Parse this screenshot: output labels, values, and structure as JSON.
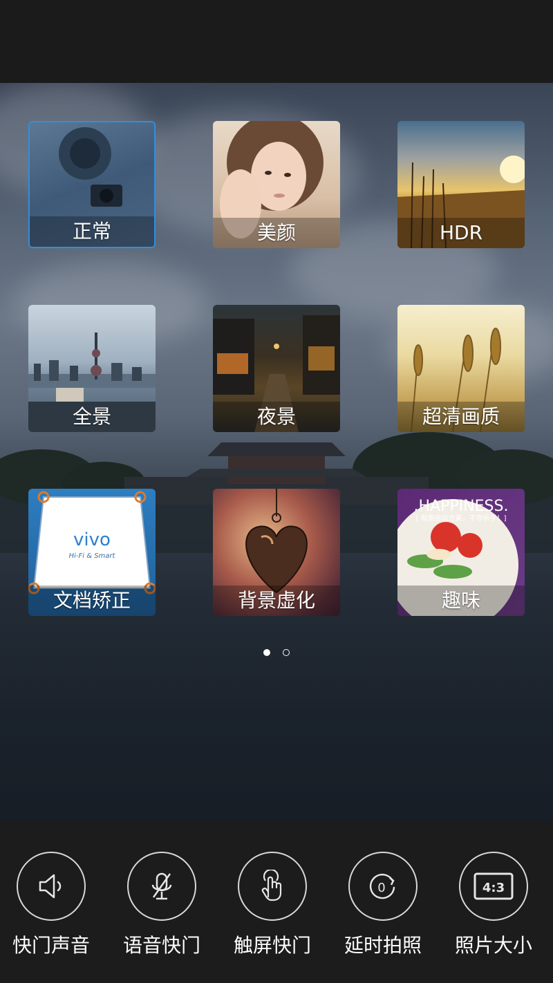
{
  "modes": [
    {
      "label": "正常",
      "selected": true
    },
    {
      "label": "美颜",
      "selected": false
    },
    {
      "label": "HDR",
      "selected": false
    },
    {
      "label": "全景",
      "selected": false
    },
    {
      "label": "夜景",
      "selected": false
    },
    {
      "label": "超清画质",
      "selected": false
    },
    {
      "label": "文档矫正",
      "selected": false,
      "logo_text": "vivo",
      "logo_subtext": "Hi-Fi & Smart"
    },
    {
      "label": "背景虚化",
      "selected": false
    },
    {
      "label": "趣味",
      "selected": false,
      "overlay_text": ".HAPPINESS.",
      "overlay_subtext": "[ 有朋自远方来，不亦乐乎！]"
    }
  ],
  "pager": {
    "pages": 2,
    "current": 1
  },
  "settings": [
    {
      "label": "快门声音",
      "icon": "speaker-icon"
    },
    {
      "label": "语音快门",
      "icon": "microphone-muted-icon"
    },
    {
      "label": "触屏快门",
      "icon": "touch-hand-icon"
    },
    {
      "label": "延时拍照",
      "icon": "timer-icon"
    },
    {
      "label": "照片大小",
      "icon": "aspect-ratio-icon",
      "icon_text": "4:3"
    }
  ],
  "colors": {
    "selected_border": "#2f8fe0",
    "bar_bg": "#1c1c1c",
    "label_color": "#ffffff"
  }
}
